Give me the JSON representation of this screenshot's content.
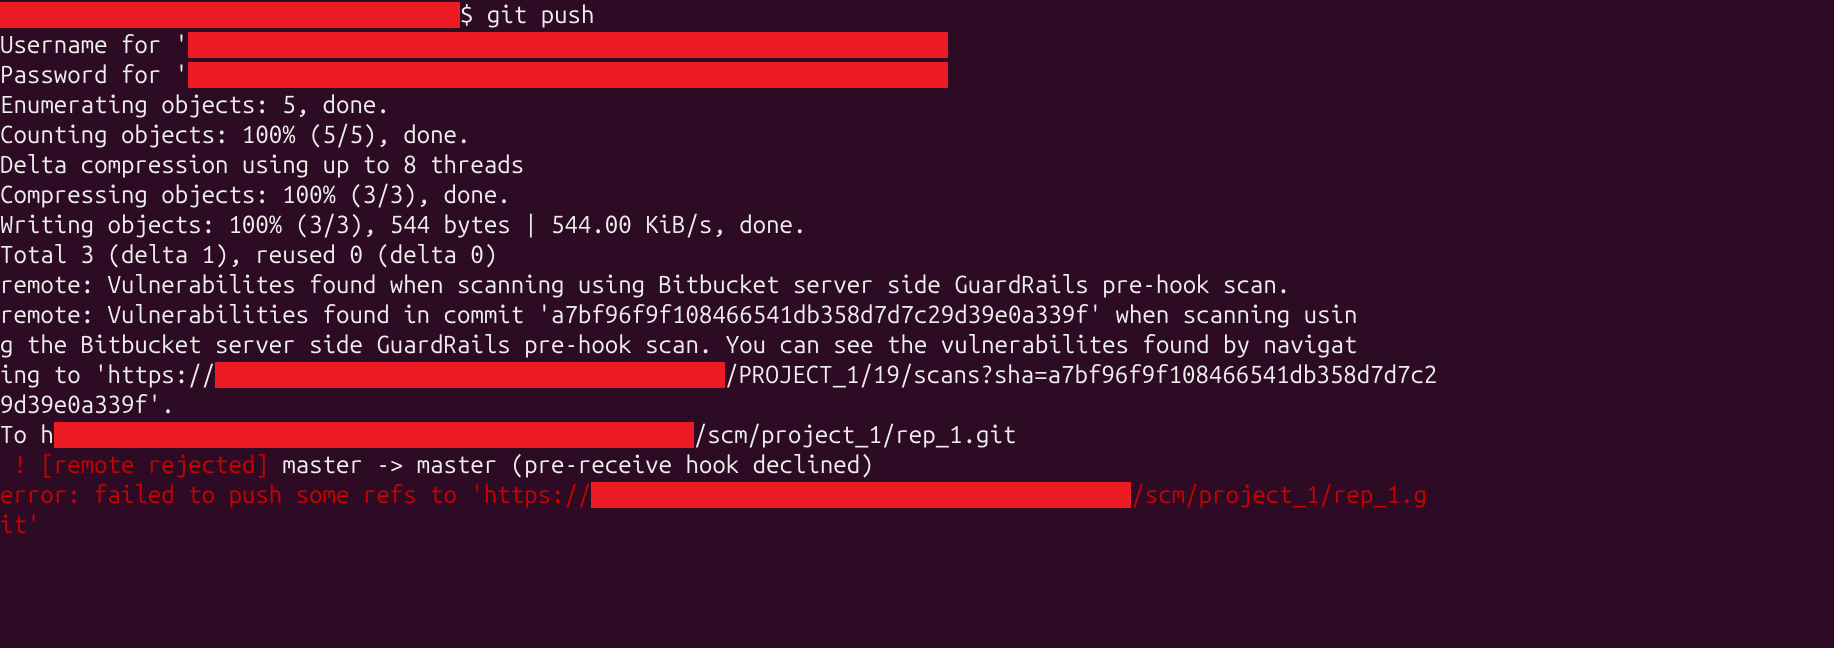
{
  "prompt_suffix": "$ ",
  "command": "git push",
  "username_prefix": "Username for '",
  "password_prefix": "Password for '",
  "enumerating": "Enumerating objects: 5, done.",
  "counting": "Counting objects: 100% (5/5), done.",
  "delta_compression": "Delta compression using up to 8 threads",
  "compressing": "Compressing objects: 100% (3/3), done.",
  "writing": "Writing objects: 100% (3/3), 544 bytes | 544.00 KiB/s, done.",
  "total": "Total 3 (delta 1), reused 0 (delta 0)",
  "remote1": "remote: Vulnerabilites found when scanning using Bitbucket server side GuardRails pre-hook scan.",
  "remote2a": "remote: Vulnerabilities found in commit 'a7bf96f9f108466541db358d7d7c29d39e0a339f' when scanning usin",
  "remote2b": "g the Bitbucket server side GuardRails pre-hook scan. You can see the vulnerabilites found by navigat",
  "remote2c": "ing to 'https://",
  "remote2d": "/PROJECT_1/19/scans?sha=a7bf96f9f108466541db358d7d7c2",
  "remote2e": "9d39e0a339f'.",
  "to_prefix": "To h",
  "to_suffix": "/scm/project_1/rep_1.git",
  "rejected_prefix": " ! [remote rejected] ",
  "rejected_suffix": "master -> master (pre-receive hook declined)",
  "error_prefix": "error: failed to push some refs to 'https://",
  "error_suffix1": "/scm/project_1/rep_1.g",
  "error_suffix2": "it'",
  "redacted_widths": {
    "prompt": "460px",
    "username": "760px",
    "password": "760px",
    "url": "510px",
    "to": "640px",
    "error": "540px"
  }
}
